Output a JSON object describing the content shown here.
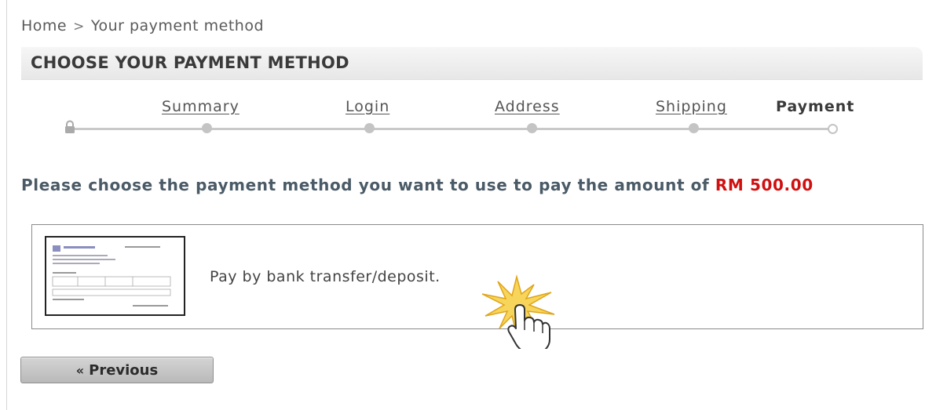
{
  "breadcrumb": {
    "home": "Home",
    "separator": ">",
    "current": "Your payment method"
  },
  "page_title": "CHOOSE YOUR PAYMENT METHOD",
  "steps": [
    {
      "label": "Summary",
      "state": "done"
    },
    {
      "label": "Login",
      "state": "done"
    },
    {
      "label": "Address",
      "state": "done"
    },
    {
      "label": "Shipping",
      "state": "done"
    },
    {
      "label": "Payment",
      "state": "current"
    }
  ],
  "prompt": {
    "text": "Please choose the payment method you want to use to pay the amount of",
    "amount": "RM 500.00"
  },
  "payment_option": {
    "label": "Pay by bank transfer/deposit.",
    "icon": "cheque-thumbnail"
  },
  "previous_button": {
    "chevron": "«",
    "label": "Previous"
  },
  "colors": {
    "amount": "#d01010",
    "prompt": "#4a5a66",
    "track": "#c9c9c9"
  }
}
